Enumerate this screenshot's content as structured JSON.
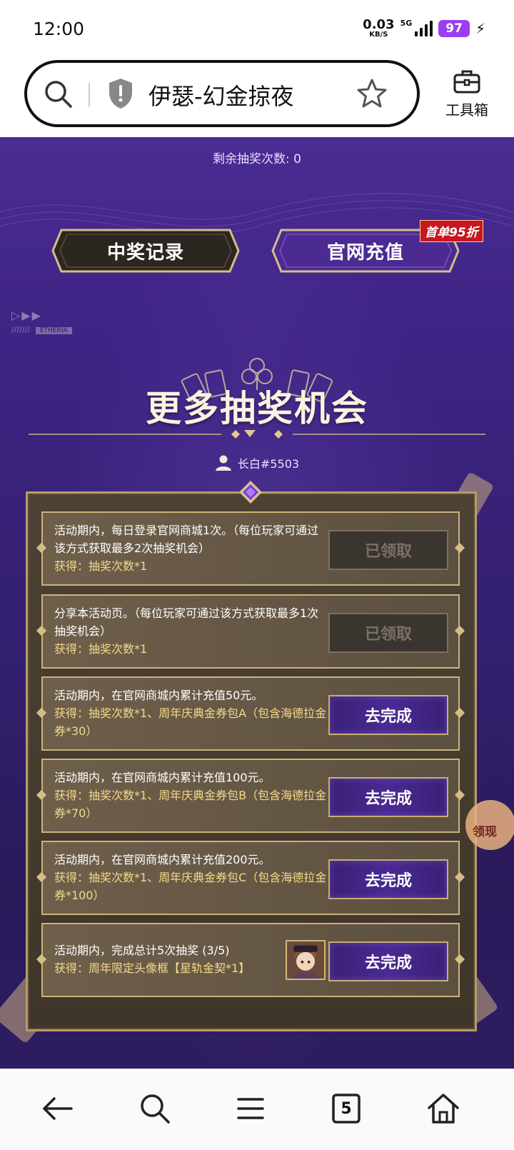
{
  "status_bar": {
    "time": "12:00",
    "net_speed": "0.03",
    "net_speed_unit": "KB/S",
    "network_type": "5G",
    "battery": "97",
    "icons": [
      "signal-icon",
      "charging-icon"
    ]
  },
  "address_bar": {
    "title": "伊瑟-幻金掠夜",
    "toolbox_label": "工具箱",
    "icons": [
      "search-icon",
      "shield-icon",
      "star-icon",
      "toolbox-icon"
    ]
  },
  "game": {
    "remaining_draws": "剩余抽奖次数: 0",
    "buttons": {
      "record": "中奖记录",
      "recharge": "官网充值",
      "recharge_badge": "首单95折"
    },
    "brand_tag": "ETHERIA",
    "section_title": "更多抽奖机会",
    "user_name": "长白#5503",
    "side_tab_label": "领现",
    "tasks": [
      {
        "desc": "活动期内，每日登录官网商城1次。（每位玩家可通过该方式获取最多2次抽奖机会）",
        "reward": "获得：抽奖次数*1",
        "action": "已领取",
        "state": "done"
      },
      {
        "desc": "分享本活动页。（每位玩家可通过该方式获取最多1次抽奖机会）",
        "reward": "获得：抽奖次数*1",
        "action": "已领取",
        "state": "done"
      },
      {
        "desc": "活动期内，在官网商城内累计充值50元。",
        "reward": "获得：抽奖次数*1、周年庆典金券包A（包含海德拉金券*30）",
        "action": "去完成",
        "state": "todo"
      },
      {
        "desc": "活动期内，在官网商城内累计充值100元。",
        "reward": "获得：抽奖次数*1、周年庆典金券包B（包含海德拉金券*70）",
        "action": "去完成",
        "state": "todo"
      },
      {
        "desc": "活动期内，在官网商城内累计充值200元。",
        "reward": "获得：抽奖次数*1、周年庆典金券包C（包含海德拉金券*100）",
        "action": "去完成",
        "state": "todo"
      },
      {
        "desc": "活动期内，完成总计5次抽奖 (3/5)",
        "reward": "获得：周年限定头像框【星轨金契*1】",
        "action": "去完成",
        "state": "todo",
        "has_avatar": true
      }
    ]
  },
  "nav_bar": {
    "tab_count": "5",
    "icons": [
      "back-icon",
      "search-icon",
      "menu-icon",
      "tabs-icon",
      "home-icon"
    ]
  }
}
